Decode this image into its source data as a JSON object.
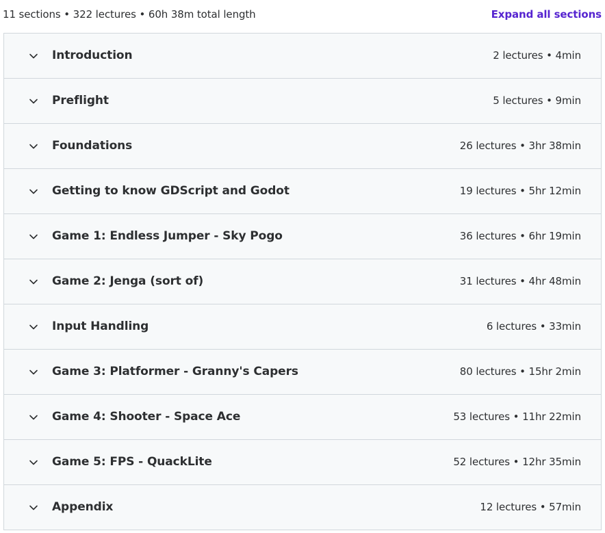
{
  "summary": {
    "text": "11 sections • 322 lectures • 60h 38m total length",
    "expand_label": "Expand all sections"
  },
  "colors": {
    "accent": "#5624d0",
    "row_background": "#f7f9fa",
    "border": "#d1d7dc",
    "text": "#2d2f31"
  },
  "sections": [
    {
      "title": "Introduction",
      "meta": "2 lectures • 4min",
      "icon": "chevron-down-icon"
    },
    {
      "title": "Preflight",
      "meta": "5 lectures • 9min",
      "icon": "chevron-down-icon"
    },
    {
      "title": "Foundations",
      "meta": "26 lectures • 3hr 38min",
      "icon": "chevron-down-icon"
    },
    {
      "title": "Getting to know GDScript and Godot",
      "meta": "19 lectures • 5hr 12min",
      "icon": "chevron-down-icon"
    },
    {
      "title": "Game 1: Endless Jumper - Sky Pogo",
      "meta": "36 lectures • 6hr 19min",
      "icon": "chevron-down-icon"
    },
    {
      "title": "Game 2: Jenga (sort of)",
      "meta": "31 lectures • 4hr 48min",
      "icon": "chevron-down-icon"
    },
    {
      "title": "Input Handling",
      "meta": "6 lectures • 33min",
      "icon": "chevron-down-icon"
    },
    {
      "title": "Game 3: Platformer - Granny's Capers",
      "meta": "80 lectures • 15hr 2min",
      "icon": "chevron-down-icon"
    },
    {
      "title": "Game 4: Shooter - Space Ace",
      "meta": "53 lectures • 11hr 22min",
      "icon": "chevron-down-icon"
    },
    {
      "title": "Game 5: FPS - QuackLite",
      "meta": "52 lectures • 12hr 35min",
      "icon": "chevron-down-icon"
    },
    {
      "title": "Appendix",
      "meta": "12 lectures • 57min",
      "icon": "chevron-down-icon"
    }
  ]
}
